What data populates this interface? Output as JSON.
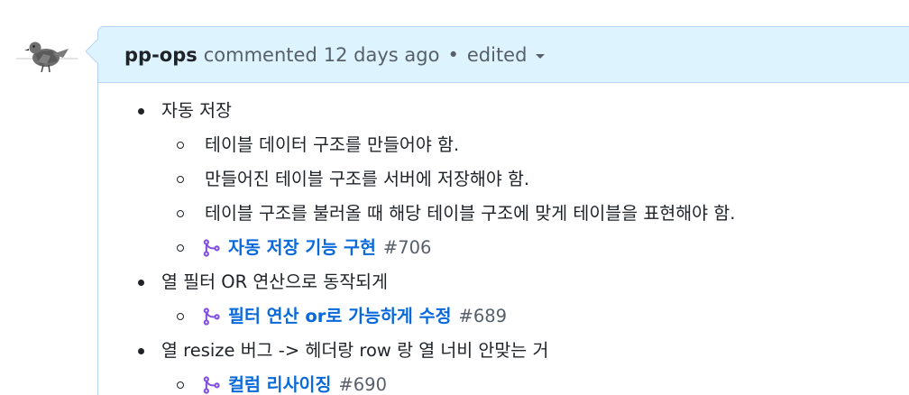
{
  "comment": {
    "author": "pp-ops",
    "action": "commented",
    "timestamp": "12 days ago",
    "separator": "•",
    "edited_label": "edited"
  },
  "body": {
    "items": [
      {
        "label": "자동 저장",
        "subitems": [
          {
            "type": "text",
            "label": "테이블 데이터 구조를 만들어야 함."
          },
          {
            "type": "text",
            "label": "만들어진 테이블 구조를 서버에 저장해야 함."
          },
          {
            "type": "text",
            "label": "테이블 구조를 불러올 때 해당 테이블 구조에 맞게 테이블을 표현해야 함."
          },
          {
            "type": "pr",
            "icon": "git-merge-icon",
            "title": "자동 저장 기능 구현",
            "number": "#706"
          }
        ]
      },
      {
        "label": "열 필터 OR 연산으로 동작되게",
        "subitems": [
          {
            "type": "pr",
            "icon": "git-merge-icon",
            "title": "필터 연산 or로 가능하게 수정",
            "number": "#689"
          }
        ]
      },
      {
        "label": "열 resize 버그 -> 헤더랑 row 랑 열 너비 안맞는 거",
        "subitems": [
          {
            "type": "pr",
            "icon": "git-merge-icon",
            "title": "컬럼 리사이징",
            "number": "#690"
          }
        ]
      }
    ]
  },
  "colors": {
    "header_bg": "#ddf4ff",
    "header_border": "#b6d4f7",
    "link": "#0969da",
    "merged_icon": "#8250df",
    "muted": "#57606a"
  }
}
